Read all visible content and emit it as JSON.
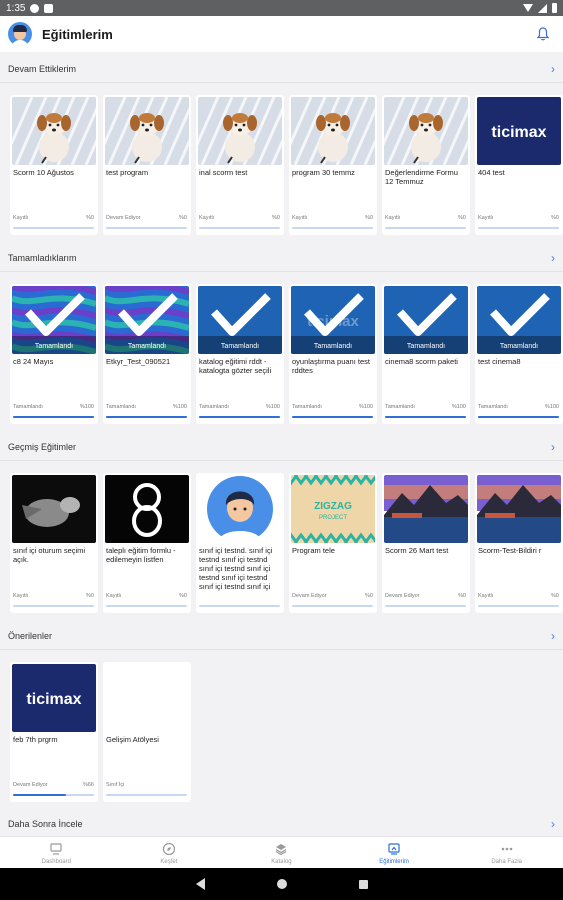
{
  "status_bar": {
    "time": "1:35"
  },
  "app_bar": {
    "title": "Eğitimlerim"
  },
  "sections": [
    {
      "title": "Devam Ettiklerim",
      "cards": [
        {
          "title": "Scorm 10 Ağustos",
          "status": "Kayıtlı",
          "pct": "%0",
          "progress": 0,
          "thumb": "dog"
        },
        {
          "title": "test program",
          "status": "Devam Ediyor",
          "pct": "%0",
          "progress": 0,
          "thumb": "dog"
        },
        {
          "title": "inal scorm test",
          "status": "Kayıtlı",
          "pct": "%0",
          "progress": 0,
          "thumb": "dog"
        },
        {
          "title": "program 30 temmz",
          "status": "Kayıtlı",
          "pct": "%0",
          "progress": 0,
          "thumb": "dog"
        },
        {
          "title": "Değerlendirme Formu 12 Temmuz",
          "status": "Kayıtlı",
          "pct": "%0",
          "progress": 0,
          "thumb": "dog"
        },
        {
          "title": "404 test",
          "status": "Kayıtlı",
          "pct": "%0",
          "progress": 0,
          "thumb": "ticimax",
          "thumb_text": "ticimax"
        }
      ]
    },
    {
      "title": "Tamamladıklarım",
      "cards": [
        {
          "title": "c8 24 Mayıs",
          "status": "Tamamlandı",
          "pct": "%100",
          "progress": 1,
          "thumb": "check-wave",
          "thumb_text": "Tamamlandı"
        },
        {
          "title": "Etkyr_Test_090521",
          "status": "Tamamlandı",
          "pct": "%100",
          "progress": 1,
          "thumb": "check-wave",
          "thumb_text": "Tamamlandı"
        },
        {
          "title": "katalog eğitimi rddt - katalogta gözter seçili",
          "status": "Tamamlandı",
          "pct": "%100",
          "progress": 1,
          "thumb": "check-blue",
          "thumb_text": "Tamamlandı"
        },
        {
          "title": "oyunlaştırma puanı test rddtes",
          "status": "Tamamlandı",
          "pct": "%100",
          "progress": 1,
          "thumb": "check-ticimax",
          "thumb_text": "Tamamlandı"
        },
        {
          "title": "cinema8 scorm paketi",
          "status": "Tamamlandı",
          "pct": "%100",
          "progress": 1,
          "thumb": "check-blue",
          "thumb_text": "Tamamlandı"
        },
        {
          "title": "test cinema8",
          "status": "Tamamlandı",
          "pct": "%100",
          "progress": 1,
          "thumb": "check-blue",
          "thumb_text": "Tamamlandı"
        }
      ]
    },
    {
      "title": "Geçmiş Eğitimler",
      "cards": [
        {
          "title": " sınıf içi oturum seçimi açık.",
          "status": "Kayıtlı",
          "pct": "%0",
          "progress": 0,
          "thumb": "bird"
        },
        {
          "title": " taleplı eğitim formlu - edilemeyin listfen",
          "status": "Kayıtlı",
          "pct": "%0",
          "progress": 0,
          "thumb": "eight"
        },
        {
          "title": "sınıf içi testnd. sınıf içi testnd  sınıf içi testnd sınıf içi testnd sınıf içi testnd sınıf içi testnd sınıf içi testnd sınıf içi testnd",
          "status": "",
          "pct": "",
          "progress": 0,
          "thumb": "avatar"
        },
        {
          "title": "Program tele",
          "status": "Devam Ediyor",
          "pct": "%0",
          "progress": 0,
          "thumb": "zigzag",
          "thumb_text": "ZIGZAG",
          "thumb_subtext": "PROJECT"
        },
        {
          "title": "Scorm 26 Mart test",
          "status": "Devam Ediyor",
          "pct": "%0",
          "progress": 0,
          "thumb": "lake"
        },
        {
          "title": "Scorm-Test-Bildiri r",
          "status": "Kayıtlı",
          "pct": "%0",
          "progress": 0,
          "thumb": "lake"
        }
      ]
    },
    {
      "title": "Önerilenler",
      "cards": [
        {
          "title": "feb 7th prgrm",
          "status": "Devam Ediyor",
          "pct": "%66",
          "progress": 0.66,
          "thumb": "ticimax",
          "thumb_text": "ticimax"
        },
        {
          "title": "Gelişim Atölyesi",
          "status": "Sınıf İçi",
          "pct": "",
          "progress": 0,
          "thumb": "blank"
        }
      ]
    },
    {
      "title": "Daha Sonra İncele",
      "cards": []
    }
  ],
  "bottom_nav": [
    {
      "label": "Dashboard",
      "icon": "dashboard-icon",
      "active": false
    },
    {
      "label": "Keşfet",
      "icon": "compass-icon",
      "active": false
    },
    {
      "label": "Katalog",
      "icon": "layers-icon",
      "active": false
    },
    {
      "label": "Eğitimlerim",
      "icon": "my-trainings-icon",
      "active": true
    },
    {
      "label": "Daha Fazla",
      "icon": "more-icon",
      "active": false
    }
  ],
  "colors": {
    "accent": "#2f6fd8",
    "progress_track": "#c9d8f2",
    "ticimax_bg": "#1a2a6c"
  }
}
